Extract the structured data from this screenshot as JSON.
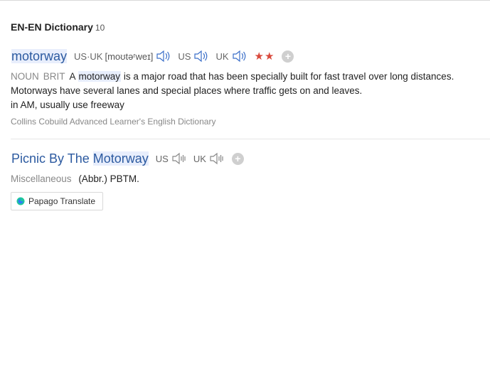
{
  "dictionary": {
    "title": "EN-EN Dictionary",
    "count": "10"
  },
  "entry1": {
    "headword": "motorway",
    "pron_label": "US·UK",
    "ipa": "[moʊtəʳweɪ]",
    "us_label": "US",
    "uk_label": "UK",
    "stars": "★★",
    "pos": "NOUN",
    "region": "BRIT",
    "def_pre": "A",
    "def_word": "motorway",
    "def_post": "is a major road that has been specially built for fast travel over long distances.",
    "def_line2": "Motorways have several lanes and special places where traffic gets on and leaves.",
    "def_line3": "in AM, usually use freeway",
    "source": "Collins Cobuild Advanced Learner's English Dictionary"
  },
  "entry2": {
    "headword_pre": "Picnic By The",
    "headword_hl": "Motorway",
    "us_label": "US",
    "uk_label": "UK",
    "pos": "Miscellaneous",
    "def": "(Abbr.) PBTM."
  },
  "papago": {
    "label": "Papago Translate"
  },
  "colors": {
    "link_blue": "#2c5aa0",
    "highlight": "#e8eefc",
    "star_red": "#d9493c"
  }
}
